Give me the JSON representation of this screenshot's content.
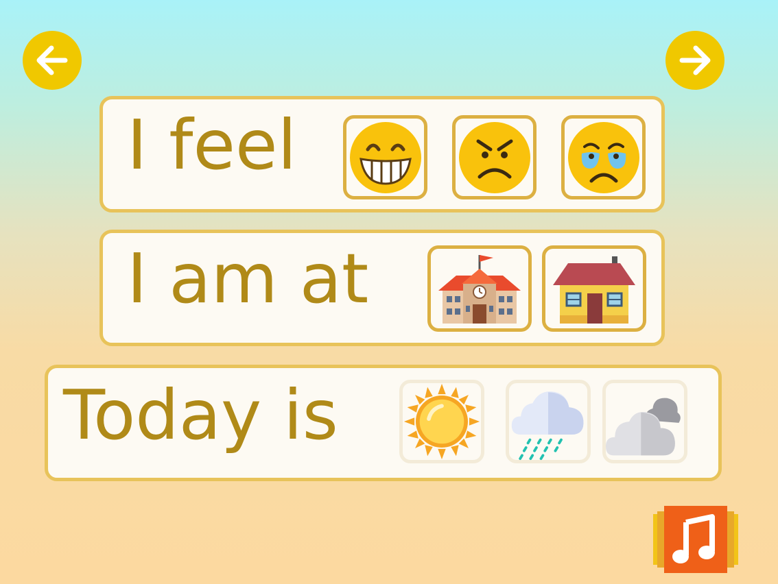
{
  "navigation": {
    "back_icon": "arrow-left-icon",
    "forward_icon": "arrow-right-icon"
  },
  "rows": [
    {
      "label": "I feel",
      "choices": [
        "grinning-face-icon",
        "angry-face-icon",
        "crying-face-icon"
      ]
    },
    {
      "label": "I am at",
      "choices": [
        "school-building-icon",
        "house-icon"
      ]
    },
    {
      "label": "Today is",
      "choices": [
        "sun-icon",
        "rain-cloud-icon",
        "cloudy-icon"
      ]
    }
  ],
  "music": {
    "icon": "music-note-icon"
  },
  "colors": {
    "accent_yellow": "#f0c800",
    "text_gold": "#b08a18",
    "border_gold": "#e8c35a",
    "music_orange": "#ef6018"
  }
}
